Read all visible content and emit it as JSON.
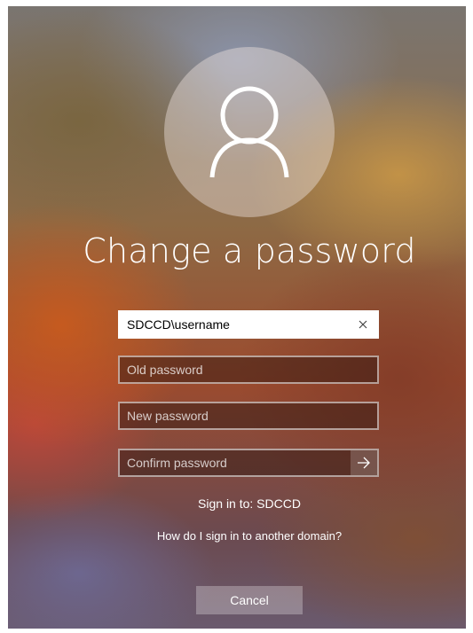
{
  "title": "Change a password",
  "icons": {
    "avatar": "user-icon",
    "clear": "close-icon",
    "submit": "arrow-right-icon"
  },
  "fields": {
    "username": {
      "value": "SDCCD\\username",
      "placeholder": ""
    },
    "old_password": {
      "value": "",
      "placeholder": "Old password"
    },
    "new_password": {
      "value": "",
      "placeholder": "New password"
    },
    "confirm_password": {
      "value": "",
      "placeholder": "Confirm password"
    }
  },
  "sign_in_to": "Sign in to: SDCCD",
  "domain_help": "How do I sign in to another domain?",
  "cancel_label": "Cancel"
}
